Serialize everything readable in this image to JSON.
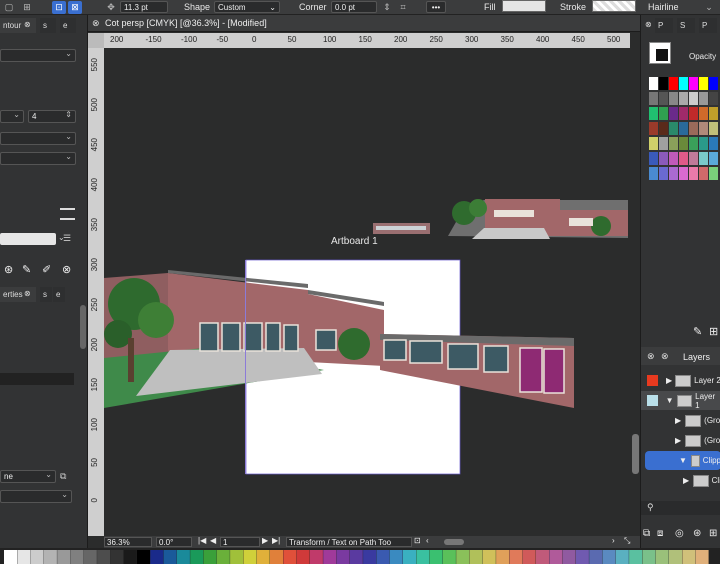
{
  "toolbar": {
    "stroke_width": "11.3 pt",
    "shape_label": "Shape",
    "shape_value": "Custom",
    "corner_label": "Corner",
    "corner_value": "0.0 pt",
    "more": "•••",
    "fill_label": "Fill",
    "stroke_label": "Stroke",
    "stroke_style": "Hairline"
  },
  "left_panel": {
    "tab_contour": "ntour",
    "tab_s": "s",
    "value_4": "4",
    "tab_properties": "erties",
    "tab_s2": "s",
    "tab_e": "e",
    "blend_value": "ne"
  },
  "document": {
    "tab_title": "Cot persp [CMYK] [@36.3%] - [Modified]",
    "artboard_label": "Artboard 1"
  },
  "rulers": {
    "h_ticks": [
      "200",
      "-150",
      "-100",
      "-50",
      "0",
      "50",
      "100",
      "150",
      "200",
      "250",
      "300",
      "350",
      "400",
      "450",
      "500"
    ],
    "v_ticks": [
      "550",
      "500",
      "450",
      "400",
      "350",
      "300",
      "250",
      "200",
      "150",
      "100",
      "50",
      "0"
    ]
  },
  "statusbar": {
    "zoom": "36.3%",
    "rotation": "0.0°",
    "page": "1",
    "tool_hint": "Transform / Text on Path Too"
  },
  "right_panel": {
    "tab_p": "P",
    "tab_s": "S",
    "tab_p2": "P",
    "opacity_label": "Opacity",
    "layers_title": "Layers",
    "layers": [
      {
        "name": "Layer 2",
        "color": "#e83a1f"
      },
      {
        "name": "Layer 1",
        "color": "#b9dfe9"
      },
      {
        "name": "(Gro"
      },
      {
        "name": "(Gro"
      },
      {
        "name": "Clipp"
      },
      {
        "name": "Cli"
      }
    ]
  },
  "colors": {
    "accent": "#3a6fd0",
    "swatches": [
      "#ffffff",
      "#000000",
      "#ff0000",
      "#00ffff",
      "#ff00ff",
      "#ffff00",
      "#0000ff",
      "#00ff00"
    ]
  }
}
